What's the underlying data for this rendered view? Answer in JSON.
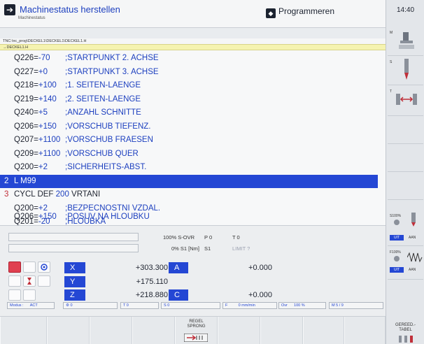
{
  "header": {
    "mode_left": "Machinestatus herstellen",
    "mode_sub": "Machinestatus",
    "mode_right": "Programmeren"
  },
  "pathbar": "TNC:\\nc_prog\\DECKEL1\\DECKEL1\\DECKEL1.H",
  "filebar": "→DECKEL1.H",
  "program": [
    {
      "param": "Q226=",
      "value": "-70",
      "comment": ";STARTPUNKT 2. ACHSE"
    },
    {
      "param": "Q227=",
      "value": "+0",
      "comment": ";STARTPUNKT 3. ACHSE"
    },
    {
      "param": "Q218=",
      "value": "+100",
      "comment": ";1. SEITEN-LAENGE"
    },
    {
      "param": "Q219=",
      "value": "+140",
      "comment": ";2. SEITEN-LAENGE"
    },
    {
      "param": "Q240=",
      "value": "+5",
      "comment": ";ANZAHL SCHNITTE"
    },
    {
      "param": "Q206=",
      "value": "+150",
      "comment": ";VORSCHUB TIEFENZ."
    },
    {
      "param": "Q207=",
      "value": "+1100",
      "comment": ";VORSCHUB FRAESEN"
    },
    {
      "param": "Q209=",
      "value": "+1100",
      "comment": ";VORSCHUB QUER"
    },
    {
      "param": "Q200=",
      "value": "+2",
      "comment": ";SICHERHEITS-ABST."
    }
  ],
  "selected_line": {
    "number": "2",
    "text": "L  M99"
  },
  "cycle_line": {
    "number": "3",
    "kw": "CYCL DEF",
    "num": "200",
    "name": "VRTANI"
  },
  "program2": [
    {
      "param": "Q200=",
      "value": "+2",
      "comment": ";BEZPECNOSTNI VZDAL."
    },
    {
      "param": "Q201=",
      "value": "-20",
      "comment": ";HLOUBKA"
    },
    {
      "param": "Q206=",
      "value": "+150",
      "comment": ";POSUV NA HLOUBKU"
    }
  ],
  "status": {
    "s_ovr": "100% S-OVR",
    "p0": "P 0",
    "t0": "T 0",
    "s1": "0% S1 [Nm]",
    "s1b": "S1",
    "limit": "LIMIT ?"
  },
  "axes": [
    {
      "label": "X",
      "value": "+303.300",
      "label2": "A",
      "value2": "+0.000"
    },
    {
      "label": "Y",
      "value": "+175.110",
      "label2": "",
      "value2": ""
    },
    {
      "label": "Z",
      "value": "+218.880",
      "label2": "C",
      "value2": "+0.000"
    }
  ],
  "infobar": {
    "modus": "Modus :",
    "act": "ACT",
    "f0": "⚙ 0",
    "t0": "T 0",
    "s0": "S 0",
    "f": "F",
    "fval": "0 mm/min",
    "ovr": "Ovr",
    "ovrval": "100 %",
    "m": "M 5 / 9"
  },
  "softkeys": {
    "regel_l1": "REGEL",
    "regel_l2": "SPRONG",
    "gereed_l1": "GEREED.-",
    "gereed_l2": "TABEL"
  },
  "sidebar": {
    "clock": "14:40",
    "m": "M",
    "s": "S",
    "t": "T",
    "s100": "S100%",
    "f100": "F100%",
    "uit": "UIT",
    "aan": "AAN"
  },
  "colors": {
    "accent": "#2447d4",
    "line_number": "#c0303a",
    "filebar": "#f5f3b0"
  }
}
